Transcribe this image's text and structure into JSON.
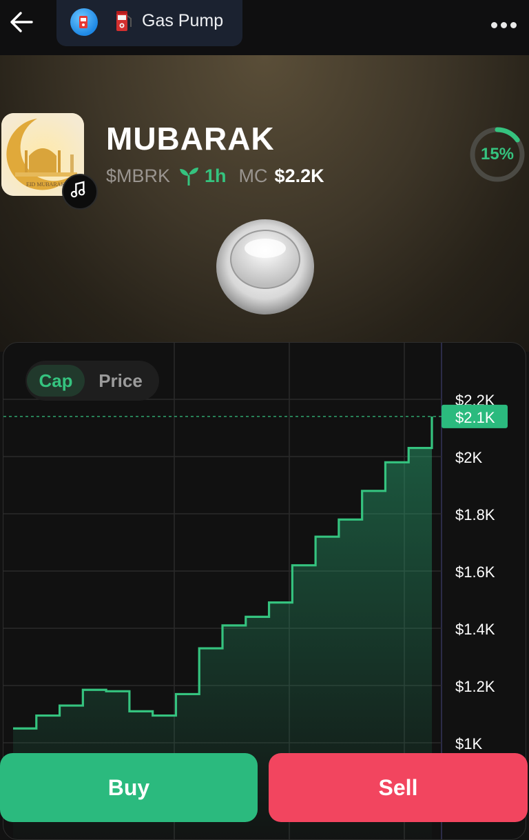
{
  "nav": {
    "pill_label": "Gas Pump"
  },
  "token": {
    "name": "MUBARAK",
    "ticker": "$MBRK",
    "age": "1h",
    "mc_label": "MC",
    "mc_value": "$2.2K",
    "progress_label": "15%",
    "progress": 0.15,
    "image_text": "EID MUBARAK"
  },
  "colors": {
    "accent_green": "#35c37f",
    "buy": "#2bba7e",
    "sell": "#f2455f"
  },
  "chart_toggle": {
    "active": "Cap",
    "other": "Price"
  },
  "chart_data": {
    "type": "line",
    "step": true,
    "ylim": [
      1000,
      2250
    ],
    "yticks": [
      "$2.2K",
      "$2K",
      "$1.8K",
      "$1.6K",
      "$1.4K",
      "$1.2K",
      "$1K"
    ],
    "ytick_values": [
      2200,
      2000,
      1800,
      1600,
      1400,
      1200,
      1000
    ],
    "current_label": "$2.1K",
    "current_value": 2100,
    "values": [
      1050,
      1095,
      1130,
      1185,
      1180,
      1110,
      1095,
      1170,
      1330,
      1410,
      1440,
      1490,
      1620,
      1720,
      1780,
      1880,
      1980,
      2030,
      2100
    ]
  },
  "actions": {
    "buy": "Buy",
    "sell": "Sell"
  }
}
